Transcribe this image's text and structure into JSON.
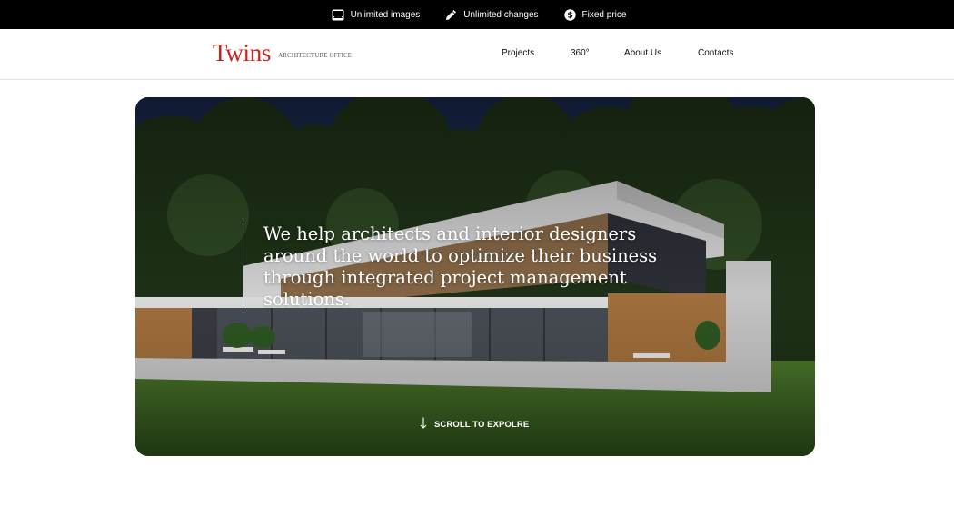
{
  "topbar": {
    "items": [
      {
        "icon": "image-icon",
        "label": "Unlimited images"
      },
      {
        "icon": "pencil-icon",
        "label": "Unlimited changes"
      },
      {
        "icon": "dollar-icon",
        "label": "Fixed price"
      }
    ]
  },
  "header": {
    "logo": {
      "word": "Twins",
      "subtitle": "ARCHITECTURE OFFICE"
    },
    "nav": [
      {
        "label": "Projects"
      },
      {
        "label": "360°"
      },
      {
        "label": "About Us"
      },
      {
        "label": "Contacts"
      }
    ]
  },
  "hero": {
    "headline": "We help architects and interior designers around the world to optimize their business through integrated project management solutions.",
    "cta": {
      "icon": "arrow-down-icon",
      "label": "SCROLL TO EXPOLRE"
    }
  },
  "colors": {
    "topbar_bg": "#000000",
    "brand_red": "#c8231b",
    "hero_sky": "#1c2b4a",
    "grass": "#3f6a25"
  }
}
